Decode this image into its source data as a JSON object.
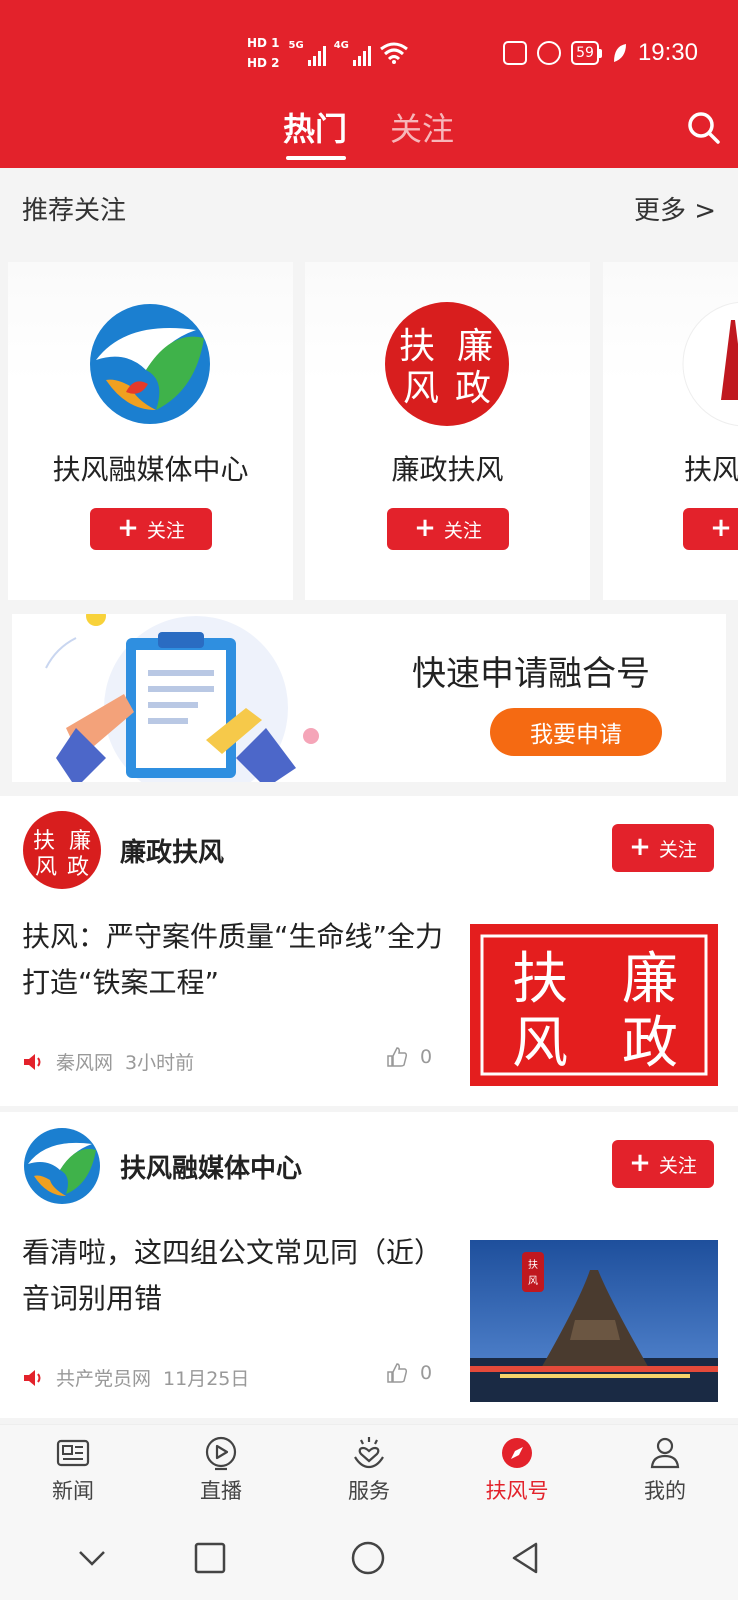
{
  "status_bar": {
    "hd1": "HD 1",
    "hd2": "HD 2",
    "sim1_label": "5G",
    "sim2_label": "4G",
    "battery": "59",
    "time": "19:30"
  },
  "header": {
    "tabs": [
      {
        "label": "热门",
        "active": true
      },
      {
        "label": "关注",
        "active": false
      }
    ],
    "accent_color": "#e3222b"
  },
  "recommend": {
    "title": "推荐关注",
    "more": "更多 >",
    "cards": [
      {
        "name": "扶风融媒体中心",
        "follow": "关注",
        "logo": "rongmei-logo"
      },
      {
        "name": "廉政扶风",
        "follow": "关注",
        "logo": "lianzheng-logo"
      },
      {
        "name": "扶风",
        "follow": "关注",
        "logo": "partial-logo"
      }
    ]
  },
  "banner": {
    "title": "快速申请融合号",
    "button": "我要申请",
    "button_color": "#f56a12"
  },
  "feed": [
    {
      "author": "廉政扶风",
      "follow": "关注",
      "headline": "扶风：严守案件质量“生命线”全力打造“铁案工程”",
      "source": "秦风网",
      "time": "3小时前",
      "likes": "0",
      "thumb_chars": [
        "扶",
        "廉",
        "风",
        "政"
      ]
    },
    {
      "author": "扶风融媒体中心",
      "follow": "关注",
      "headline": "看清啦，这四组公文常见同（近）音词别用错",
      "source": "共产党员网",
      "time": "11月25日",
      "likes": "0",
      "thumb_chars": [
        "扶",
        "风"
      ]
    }
  ],
  "bottom_nav": [
    {
      "label": "新闻",
      "icon": "news-icon",
      "active": false
    },
    {
      "label": "直播",
      "icon": "live-icon",
      "active": false
    },
    {
      "label": "服务",
      "icon": "service-icon",
      "active": false
    },
    {
      "label": "扶风号",
      "icon": "compass-icon",
      "active": true
    },
    {
      "label": "我的",
      "icon": "profile-icon",
      "active": false
    }
  ],
  "lianzheng_chars": [
    "扶",
    "廉",
    "风",
    "政"
  ]
}
